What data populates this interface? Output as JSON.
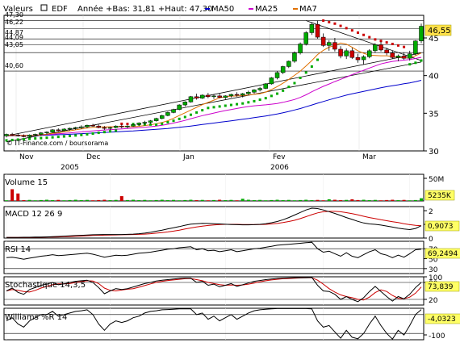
{
  "header": {
    "label": "Valeurs",
    "ticker": "EDF",
    "range_text": "Année +Bas: 31,81 +Haut: 47,30",
    "legend": [
      {
        "name": "MA50",
        "color": "#0000cc"
      },
      {
        "name": "MA25",
        "color": "#cc00cc"
      },
      {
        "name": "MA7",
        "color": "#e07000"
      }
    ]
  },
  "watermark": "© IT-Finance.com / boursorama",
  "colors": {
    "up": "#00aa00",
    "down": "#cc0000",
    "ma50": "#0000cc",
    "ma25": "#cc00cc",
    "ma7": "#e07000",
    "psar_green": "#00aa00",
    "psar_red": "#cc0000",
    "price_badge": "#ffe14a",
    "panel_badge": "#ffff66",
    "trend": "#000000"
  },
  "chart_data": [
    {
      "type": "candlestick",
      "ylim": [
        30,
        48
      ],
      "y_ticks": [
        30,
        35,
        40,
        45
      ],
      "x_labels": [
        "Nov",
        "Dec",
        "Jan",
        "Fev",
        "Mar"
      ],
      "year_labels": [
        "2005",
        "2006"
      ],
      "last_price": "46,55",
      "left_levels": [
        "47,30",
        "46,22",
        "44,87",
        "44,09",
        "43,05",
        "40,60"
      ],
      "candles": [
        [
          32.0,
          32.3,
          31.8,
          32.2
        ],
        [
          32.2,
          32.4,
          32.0,
          32.1
        ],
        [
          32.1,
          32.3,
          31.9,
          32.0
        ],
        [
          32.0,
          32.2,
          31.8,
          31.9
        ],
        [
          31.9,
          32.2,
          31.8,
          32.1
        ],
        [
          32.1,
          32.3,
          31.9,
          32.2
        ],
        [
          32.2,
          32.5,
          32.0,
          32.4
        ],
        [
          32.4,
          32.6,
          32.2,
          32.5
        ],
        [
          32.5,
          32.9,
          32.4,
          32.8
        ],
        [
          32.8,
          33.0,
          32.6,
          32.7
        ],
        [
          32.7,
          33.0,
          32.6,
          32.9
        ],
        [
          32.9,
          33.1,
          32.7,
          33.0
        ],
        [
          33.0,
          33.2,
          32.8,
          33.1
        ],
        [
          33.1,
          33.4,
          32.9,
          33.2
        ],
        [
          33.2,
          33.5,
          33.0,
          33.4
        ],
        [
          33.4,
          33.6,
          33.2,
          33.3
        ],
        [
          33.3,
          33.5,
          33.0,
          33.1
        ],
        [
          33.1,
          33.3,
          32.8,
          33.0
        ],
        [
          33.0,
          33.2,
          32.8,
          33.1
        ],
        [
          33.1,
          33.4,
          33.0,
          33.3
        ],
        [
          33.3,
          33.5,
          33.0,
          33.2
        ],
        [
          33.2,
          33.4,
          33.0,
          33.3
        ],
        [
          33.3,
          33.6,
          33.2,
          33.5
        ],
        [
          33.5,
          33.8,
          33.3,
          33.7
        ],
        [
          33.7,
          34.0,
          33.5,
          33.8
        ],
        [
          33.8,
          34.1,
          33.6,
          34.0
        ],
        [
          34.0,
          34.4,
          33.9,
          34.3
        ],
        [
          34.3,
          34.8,
          34.2,
          34.7
        ],
        [
          34.7,
          35.2,
          34.6,
          35.1
        ],
        [
          35.1,
          35.6,
          35.0,
          35.5
        ],
        [
          35.5,
          36.2,
          35.4,
          36.1
        ],
        [
          36.1,
          36.6,
          35.9,
          36.5
        ],
        [
          36.5,
          37.3,
          36.4,
          37.2
        ],
        [
          37.2,
          37.6,
          36.8,
          37.0
        ],
        [
          37.0,
          37.5,
          36.9,
          37.4
        ],
        [
          37.4,
          37.7,
          37.0,
          37.2
        ],
        [
          37.2,
          37.5,
          36.9,
          37.3
        ],
        [
          37.3,
          37.6,
          37.0,
          37.1
        ],
        [
          37.1,
          37.4,
          36.8,
          37.3
        ],
        [
          37.3,
          37.6,
          37.1,
          37.5
        ],
        [
          37.5,
          37.8,
          37.2,
          37.4
        ],
        [
          37.4,
          37.7,
          37.1,
          37.6
        ],
        [
          37.6,
          38.0,
          37.4,
          37.8
        ],
        [
          37.8,
          38.2,
          37.6,
          38.1
        ],
        [
          38.1,
          38.5,
          37.9,
          38.3
        ],
        [
          38.3,
          39.0,
          38.2,
          38.9
        ],
        [
          38.9,
          39.8,
          38.8,
          39.7
        ],
        [
          39.7,
          40.6,
          39.5,
          40.4
        ],
        [
          40.4,
          41.3,
          40.2,
          41.2
        ],
        [
          41.2,
          42.0,
          41.0,
          41.9
        ],
        [
          41.9,
          43.2,
          41.7,
          43.0
        ],
        [
          43.0,
          44.4,
          42.8,
          44.2
        ],
        [
          44.2,
          45.9,
          44.0,
          45.7
        ],
        [
          45.7,
          47.1,
          45.4,
          46.8
        ],
        [
          46.8,
          47.3,
          44.9,
          45.1
        ],
        [
          45.1,
          45.6,
          43.8,
          44.0
        ],
        [
          44.0,
          44.7,
          43.3,
          44.4
        ],
        [
          44.4,
          45.0,
          43.2,
          43.5
        ],
        [
          43.5,
          43.9,
          42.3,
          42.6
        ],
        [
          42.6,
          43.6,
          42.2,
          43.3
        ],
        [
          43.3,
          43.7,
          42.2,
          42.4
        ],
        [
          42.4,
          42.9,
          41.7,
          42.1
        ],
        [
          42.1,
          42.7,
          41.5,
          42.5
        ],
        [
          42.5,
          43.5,
          42.3,
          43.3
        ],
        [
          43.3,
          44.3,
          43.0,
          44.1
        ],
        [
          44.1,
          44.5,
          43.2,
          43.4
        ],
        [
          43.4,
          43.7,
          42.7,
          43.0
        ],
        [
          43.0,
          43.3,
          42.2,
          42.4
        ],
        [
          42.4,
          42.8,
          41.9,
          42.6
        ],
        [
          42.6,
          43.1,
          42.1,
          42.3
        ],
        [
          42.3,
          43.3,
          42.0,
          42.9
        ],
        [
          42.9,
          44.7,
          42.7,
          44.6
        ],
        [
          44.6,
          46.9,
          44.3,
          46.55
        ]
      ],
      "ma7": [
        32.0,
        32.05,
        32.06,
        32.05,
        32.04,
        32.08,
        32.13,
        32.21,
        32.34,
        32.4,
        32.54,
        32.67,
        32.8,
        32.93,
        33.04,
        33.14,
        33.18,
        33.19,
        33.2,
        33.22,
        33.24,
        33.2,
        33.21,
        33.27,
        33.36,
        33.47,
        33.6,
        33.77,
        34.01,
        34.33,
        34.7,
        35.06,
        35.42,
        35.79,
        36.14,
        36.44,
        36.74,
        37.04,
        37.2,
        37.28,
        37.3,
        37.34,
        37.41,
        37.51,
        37.6,
        37.81,
        38.14,
        38.54,
        38.99,
        39.49,
        40.03,
        40.6,
        41.27,
        42.0,
        42.79,
        43.35,
        43.78,
        44.0,
        44.32,
        44.17,
        43.76,
        43.3,
        42.96,
        42.71,
        42.67,
        42.63,
        42.63,
        42.54,
        42.4,
        42.33,
        42.35,
        42.63,
        43.0
      ],
      "ma25": [
        32.0,
        32.03,
        32.06,
        32.07,
        32.08,
        32.1,
        32.13,
        32.17,
        32.21,
        32.27,
        32.33,
        32.39,
        32.46,
        32.52,
        32.59,
        32.66,
        32.72,
        32.77,
        32.82,
        32.87,
        32.92,
        32.97,
        33.03,
        33.08,
        33.14,
        33.21,
        33.3,
        33.4,
        33.54,
        33.7,
        33.87,
        34.05,
        34.27,
        34.48,
        34.68,
        34.85,
        35.02,
        35.2,
        35.36,
        35.5,
        35.64,
        35.78,
        35.89,
        35.99,
        36.05,
        36.12,
        36.2,
        36.3,
        36.45,
        36.63,
        36.83,
        37.1,
        37.45,
        37.85,
        38.22,
        38.57,
        38.88,
        39.2,
        39.5,
        39.8,
        40.13,
        40.42,
        40.7,
        41.0,
        41.28,
        41.55,
        41.73,
        41.88,
        41.98,
        42.05,
        42.13,
        42.27,
        42.43
      ],
      "ma50": [
        32.0,
        32.01,
        32.02,
        32.03,
        32.04,
        32.05,
        32.07,
        32.09,
        32.12,
        32.15,
        32.18,
        32.21,
        32.25,
        32.29,
        32.33,
        32.37,
        32.41,
        32.45,
        32.49,
        32.53,
        32.57,
        32.62,
        32.66,
        32.71,
        32.76,
        32.81,
        32.86,
        32.92,
        32.98,
        33.05,
        33.13,
        33.21,
        33.3,
        33.4,
        33.5,
        33.6,
        33.7,
        33.8,
        33.9,
        34.0,
        34.1,
        34.2,
        34.3,
        34.41,
        34.52,
        34.64,
        34.77,
        34.91,
        35.07,
        35.24,
        35.43,
        35.63,
        35.86,
        36.1,
        36.33,
        36.56,
        36.78,
        37.0,
        37.2,
        37.4,
        37.58,
        37.75,
        37.91,
        38.07,
        38.23,
        38.38,
        38.53,
        38.66,
        38.78,
        38.91,
        39.03,
        39.19,
        39.37
      ],
      "psar": [
        31.4,
        31.45,
        31.5,
        31.55,
        31.6,
        31.65,
        31.7,
        31.75,
        31.8,
        31.86,
        31.92,
        31.98,
        32.05,
        32.12,
        32.2,
        32.3,
        32.4,
        32.5,
        32.6,
        32.7,
        33.6,
        33.58,
        33.56,
        33.54,
        33.52,
        33.5,
        33.48,
        33.6,
        33.8,
        34.0,
        34.25,
        34.5,
        34.8,
        35.1,
        35.4,
        35.7,
        35.8,
        35.9,
        36.0,
        36.1,
        36.2,
        36.3,
        36.45,
        36.6,
        36.8,
        37.0,
        37.3,
        37.6,
        38.0,
        38.5,
        39.0,
        39.7,
        40.4,
        41.2,
        42.1,
        47.3,
        47.1,
        46.9,
        46.6,
        46.3,
        46.0,
        45.7,
        45.4,
        45.1,
        44.8,
        44.6,
        44.4,
        44.2,
        44.0,
        43.8,
        41.5,
        41.7,
        42.0
      ],
      "trend_lines": [
        {
          "from": [
            0,
            32.0
          ],
          "to": [
            72,
            43.0
          ]
        },
        {
          "from": [
            0,
            31.2
          ],
          "to": [
            72,
            41.8
          ]
        },
        {
          "from": [
            52,
            47.3
          ],
          "to": [
            72,
            42.0
          ]
        }
      ]
    },
    {
      "type": "bar",
      "title": "Volume 15",
      "y_tick_labels": [
        "50M"
      ],
      "last_value": "5235K",
      "ylim": [
        0,
        50
      ],
      "spikes": {
        "1": 22,
        "2": 14,
        "20": 9,
        "41": 4,
        "56": 3,
        "60": 3,
        "72": 5
      }
    },
    {
      "type": "line",
      "title": "MACD 12 26 9",
      "y_tick_labels": [
        "2",
        "1",
        "0"
      ],
      "last_value": "0,9073",
      "ylim": [
        0,
        2.3
      ],
      "macd": [
        0.05,
        0.05,
        0.05,
        0.06,
        0.06,
        0.07,
        0.07,
        0.08,
        0.1,
        0.12,
        0.14,
        0.16,
        0.18,
        0.2,
        0.22,
        0.24,
        0.25,
        0.26,
        0.26,
        0.26,
        0.26,
        0.27,
        0.29,
        0.32,
        0.36,
        0.42,
        0.5,
        0.58,
        0.67,
        0.75,
        0.84,
        0.94,
        1.02,
        1.05,
        1.08,
        1.07,
        1.05,
        1.03,
        1.01,
        0.99,
        0.98,
        0.97,
        0.97,
        0.98,
        1.0,
        1.05,
        1.12,
        1.21,
        1.34,
        1.5,
        1.68,
        1.87,
        2.05,
        2.18,
        2.15,
        2.05,
        1.93,
        1.8,
        1.65,
        1.5,
        1.36,
        1.22,
        1.1,
        1.03,
        1.0,
        0.95,
        0.88,
        0.8,
        0.72,
        0.66,
        0.62,
        0.7,
        0.9
      ],
      "signal": [
        0.05,
        0.05,
        0.05,
        0.05,
        0.05,
        0.06,
        0.06,
        0.07,
        0.07,
        0.08,
        0.1,
        0.11,
        0.13,
        0.15,
        0.17,
        0.19,
        0.2,
        0.21,
        0.22,
        0.23,
        0.24,
        0.25,
        0.26,
        0.27,
        0.29,
        0.32,
        0.36,
        0.4,
        0.45,
        0.51,
        0.58,
        0.66,
        0.74,
        0.81,
        0.87,
        0.92,
        0.96,
        0.99,
        1.0,
        1.0,
        1.0,
        0.99,
        0.99,
        0.99,
        0.99,
        1.0,
        1.03,
        1.07,
        1.13,
        1.21,
        1.3,
        1.42,
        1.56,
        1.71,
        1.84,
        1.92,
        1.95,
        1.95,
        1.92,
        1.86,
        1.78,
        1.69,
        1.59,
        1.5,
        1.42,
        1.34,
        1.27,
        1.2,
        1.13,
        1.05,
        0.98,
        0.93,
        0.9
      ]
    },
    {
      "type": "line",
      "title": "RSI 14",
      "y_tick_labels": [
        "70",
        "50",
        "30"
      ],
      "last_value": "69,2494",
      "ylim": [
        20,
        85
      ],
      "values": [
        52,
        53,
        51,
        49,
        51,
        53,
        55,
        56,
        58,
        56,
        57,
        58,
        59,
        60,
        61,
        59,
        56,
        53,
        55,
        57,
        56,
        57,
        59,
        61,
        62,
        63,
        65,
        67,
        69,
        70,
        72,
        73,
        74,
        68,
        70,
        66,
        67,
        64,
        66,
        68,
        64,
        66,
        68,
        70,
        71,
        73,
        75,
        77,
        78,
        79,
        80,
        81,
        82,
        83,
        70,
        63,
        65,
        60,
        55,
        62,
        55,
        52,
        58,
        64,
        68,
        60,
        57,
        52,
        57,
        53,
        60,
        68,
        69.25
      ]
    },
    {
      "type": "line",
      "title": "Stochastique 14,3,5",
      "y_tick_labels": [
        "100",
        "80",
        "20"
      ],
      "last_value": "73,839",
      "ylim": [
        0,
        100
      ],
      "k": [
        50,
        60,
        45,
        38,
        55,
        62,
        70,
        74,
        80,
        72,
        75,
        80,
        84,
        86,
        88,
        80,
        62,
        40,
        50,
        58,
        55,
        58,
        64,
        70,
        76,
        80,
        85,
        88,
        90,
        92,
        94,
        95,
        95,
        80,
        84,
        70,
        74,
        65,
        70,
        76,
        66,
        72,
        78,
        84,
        87,
        90,
        92,
        94,
        95,
        96,
        97,
        97,
        97,
        98,
        70,
        50,
        48,
        38,
        20,
        30,
        20,
        12,
        26,
        48,
        66,
        48,
        30,
        14,
        30,
        22,
        38,
        62,
        80
      ],
      "d": [
        50,
        55,
        52,
        48,
        46,
        52,
        60,
        66,
        72,
        75,
        75,
        76,
        80,
        83,
        86,
        85,
        76,
        60,
        52,
        50,
        53,
        56,
        58,
        63,
        69,
        75,
        80,
        84,
        87,
        89,
        91,
        93,
        94,
        90,
        86,
        80,
        76,
        72,
        70,
        71,
        70,
        71,
        74,
        78,
        82,
        86,
        89,
        91,
        93,
        94,
        95,
        96,
        97,
        97,
        88,
        74,
        58,
        46,
        36,
        30,
        26,
        20,
        18,
        28,
        44,
        54,
        48,
        34,
        24,
        22,
        28,
        42,
        64
      ]
    },
    {
      "type": "line",
      "title": "Williams %R 14",
      "y_tick_labels": [
        "-100"
      ],
      "last_value": "-4,0323",
      "ylim": [
        -100,
        0
      ],
      "values": [
        -40,
        -30,
        -50,
        -60,
        -40,
        -30,
        -20,
        -20,
        -10,
        -25,
        -20,
        -15,
        -10,
        -8,
        -5,
        -20,
        -50,
        -70,
        -50,
        -40,
        -45,
        -40,
        -30,
        -25,
        -15,
        -10,
        -8,
        -5,
        -4,
        -3,
        -2,
        -2,
        -2,
        -20,
        -15,
        -35,
        -25,
        -40,
        -30,
        -20,
        -35,
        -25,
        -15,
        -8,
        -5,
        -3,
        -2,
        -1,
        -1,
        -1,
        -1,
        -1,
        -1,
        -2,
        -40,
        -60,
        -55,
        -75,
        -95,
        -70,
        -92,
        -97,
        -80,
        -50,
        -25,
        -55,
        -80,
        -98,
        -70,
        -85,
        -55,
        -20,
        -4.03
      ]
    }
  ]
}
